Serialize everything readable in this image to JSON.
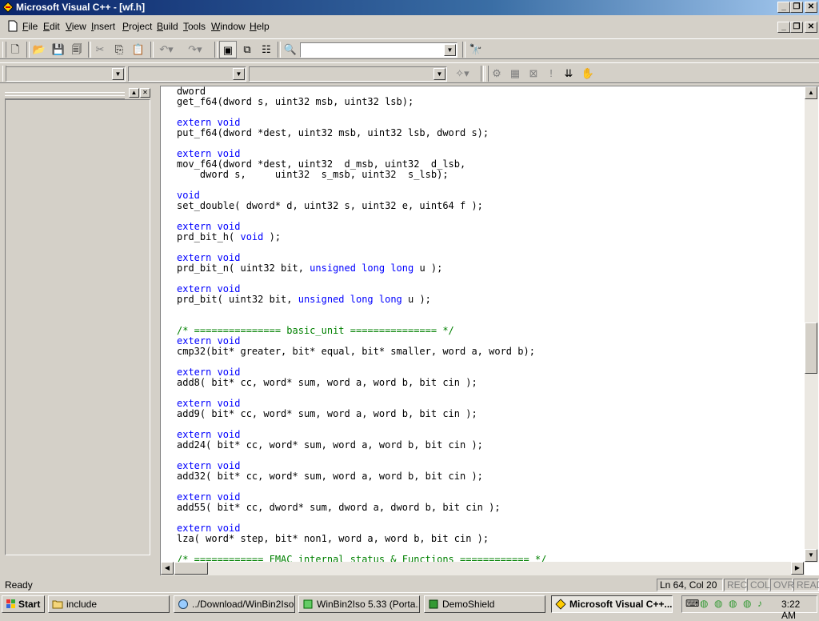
{
  "window": {
    "title": "Microsoft Visual C++ - [wf.h]"
  },
  "menu": [
    {
      "label": "File",
      "key": "F",
      "rest": "ile"
    },
    {
      "label": "Edit",
      "key": "E",
      "rest": "dit"
    },
    {
      "label": "View",
      "key": "V",
      "rest": "iew"
    },
    {
      "label": "Insert",
      "key": "I",
      "rest": "nsert"
    },
    {
      "label": "Project",
      "key": "P",
      "rest": "roject"
    },
    {
      "label": "Build",
      "key": "B",
      "rest": "uild"
    },
    {
      "label": "Tools",
      "key": "T",
      "rest": "ools"
    },
    {
      "label": "Window",
      "key": "W",
      "rest": "indow"
    },
    {
      "label": "Help",
      "key": "H",
      "rest": "elp"
    }
  ],
  "toolbar": {
    "find_combo_value": "",
    "class_combo_value": "",
    "filter_combo_value": "",
    "member_combo_value": ""
  },
  "code_lines": [
    [
      [
        "dword",
        ""
      ]
    ],
    [
      [
        "get_f64(dword s, uint32 msb, uint32 lsb);",
        ""
      ]
    ],
    [
      [
        "",
        ""
      ]
    ],
    [
      [
        "extern void",
        "kw"
      ]
    ],
    [
      [
        "put_f64(dword *dest, uint32 msb, uint32 lsb, dword s);",
        ""
      ]
    ],
    [
      [
        "",
        ""
      ]
    ],
    [
      [
        "extern void",
        "kw"
      ]
    ],
    [
      [
        "mov_f64(dword *dest, uint32  d_msb, uint32  d_lsb,",
        ""
      ]
    ],
    [
      [
        "    dword s,     uint32  s_msb, uint32  s_lsb);",
        ""
      ]
    ],
    [
      [
        "",
        ""
      ]
    ],
    [
      [
        "void",
        "kw"
      ]
    ],
    [
      [
        "set_double( dword* d, uint32 s, uint32 e, uint64 f );",
        ""
      ]
    ],
    [
      [
        "",
        ""
      ]
    ],
    [
      [
        "extern void",
        "kw"
      ]
    ],
    [
      [
        "prd_bit_h( ",
        ""
      ],
      [
        "void",
        "kw"
      ],
      [
        " );",
        ""
      ]
    ],
    [
      [
        "",
        ""
      ]
    ],
    [
      [
        "extern void",
        "kw"
      ]
    ],
    [
      [
        "prd_bit_n( uint32 bit, ",
        ""
      ],
      [
        "unsigned long long",
        "kw"
      ],
      [
        " u );",
        ""
      ]
    ],
    [
      [
        "",
        ""
      ]
    ],
    [
      [
        "extern void",
        "kw"
      ]
    ],
    [
      [
        "prd_bit( uint32 bit, ",
        ""
      ],
      [
        "unsigned long long",
        "kw"
      ],
      [
        " u );",
        ""
      ]
    ],
    [
      [
        "",
        ""
      ]
    ],
    [
      [
        "",
        ""
      ]
    ],
    [
      [
        "/* =============== basic_unit =============== */",
        "cm"
      ]
    ],
    [
      [
        "extern void",
        "kw"
      ]
    ],
    [
      [
        "cmp32(bit* greater, bit* equal, bit* smaller, word a, word b);",
        ""
      ]
    ],
    [
      [
        "",
        ""
      ]
    ],
    [
      [
        "extern void",
        "kw"
      ]
    ],
    [
      [
        "add8( bit* cc, word* sum, word a, word b, bit cin );",
        ""
      ]
    ],
    [
      [
        "",
        ""
      ]
    ],
    [
      [
        "extern void",
        "kw"
      ]
    ],
    [
      [
        "add9( bit* cc, word* sum, word a, word b, bit cin );",
        ""
      ]
    ],
    [
      [
        "",
        ""
      ]
    ],
    [
      [
        "extern void",
        "kw"
      ]
    ],
    [
      [
        "add24( bit* cc, word* sum, word a, word b, bit cin );",
        ""
      ]
    ],
    [
      [
        "",
        ""
      ]
    ],
    [
      [
        "extern void",
        "kw"
      ]
    ],
    [
      [
        "add32( bit* cc, word* sum, word a, word b, bit cin );",
        ""
      ]
    ],
    [
      [
        "",
        ""
      ]
    ],
    [
      [
        "extern void",
        "kw"
      ]
    ],
    [
      [
        "add55( bit* cc, dword* sum, dword a, dword b, bit cin );",
        ""
      ]
    ],
    [
      [
        "",
        ""
      ]
    ],
    [
      [
        "extern void",
        "kw"
      ]
    ],
    [
      [
        "lza( word* step, bit* non1, word a, word b, bit cin );",
        ""
      ]
    ],
    [
      [
        "",
        ""
      ]
    ],
    [
      [
        "/* ============ FMAC internal status & Functions ============ */",
        "cm"
      ]
    ]
  ],
  "status": {
    "message": "Ready",
    "position": "Ln 64, Col 20",
    "rec": "REC",
    "col": "COL",
    "ovr": "OVR",
    "read": "READ"
  },
  "taskbar": {
    "start": "Start",
    "tasks": [
      {
        "label": "include",
        "icon": "folder-icon"
      },
      {
        "label": "../Download/WinBin2Iso...",
        "icon": "globe-icon"
      },
      {
        "label": "WinBin2Iso 5.33 (Porta...",
        "icon": "app-icon"
      },
      {
        "label": "DemoShield",
        "icon": "app-icon"
      },
      {
        "label": "Microsoft Visual C++...",
        "icon": "vc-icon"
      }
    ],
    "clock": "3:22 AM"
  },
  "colors": {
    "keyword": "#0000ff",
    "comment": "#008000",
    "titlebar": "#0a246a"
  },
  "scroll": {
    "vertical_position": 0.56
  }
}
